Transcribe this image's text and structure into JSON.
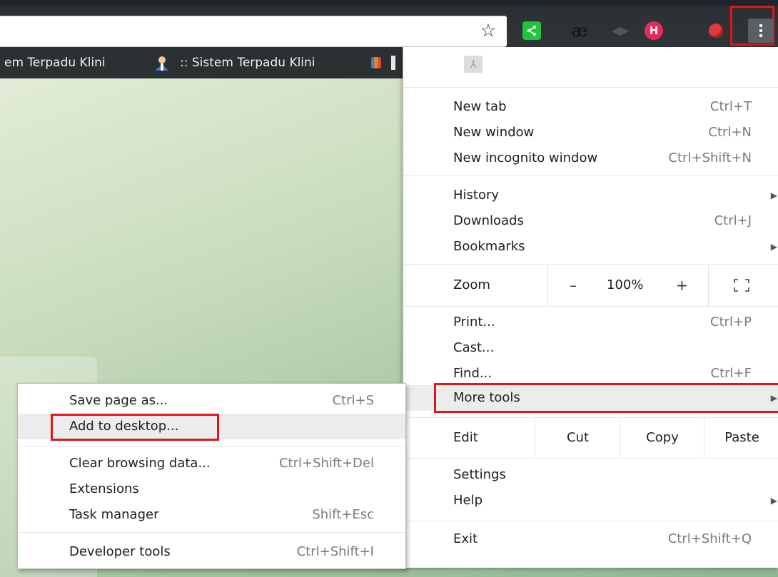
{
  "toolbar": {
    "star_icon": "☆",
    "ext_ae": "æ",
    "ext_h": "H",
    "menu_icon": "three-dot-menu"
  },
  "bookmarks": {
    "items": [
      "em Terpadu Klini",
      ":: Sistem Terpadu Klini"
    ]
  },
  "menu": {
    "new_tab": {
      "label": "New tab",
      "shortcut": "Ctrl+T"
    },
    "new_window": {
      "label": "New window",
      "shortcut": "Ctrl+N"
    },
    "new_incognito": {
      "label": "New incognito window",
      "shortcut": "Ctrl+Shift+N"
    },
    "history": {
      "label": "History"
    },
    "downloads": {
      "label": "Downloads",
      "shortcut": "Ctrl+J"
    },
    "bookmarks": {
      "label": "Bookmarks"
    },
    "zoom": {
      "label": "Zoom",
      "minus": "–",
      "value": "100%",
      "plus": "+"
    },
    "print": {
      "label": "Print...",
      "shortcut": "Ctrl+P"
    },
    "cast": {
      "label": "Cast..."
    },
    "find": {
      "label": "Find...",
      "shortcut": "Ctrl+F"
    },
    "more_tools": {
      "label": "More tools"
    },
    "edit": {
      "label": "Edit",
      "cut": "Cut",
      "copy": "Copy",
      "paste": "Paste"
    },
    "settings": {
      "label": "Settings"
    },
    "help": {
      "label": "Help"
    },
    "exit": {
      "label": "Exit",
      "shortcut": "Ctrl+Shift+Q"
    },
    "arrow": "▶"
  },
  "submenu": {
    "save_page": {
      "label": "Save page as...",
      "shortcut": "Ctrl+S"
    },
    "add_desktop": {
      "label": "Add to desktop..."
    },
    "clear_data": {
      "label": "Clear browsing data...",
      "shortcut": "Ctrl+Shift+Del"
    },
    "extensions": {
      "label": "Extensions"
    },
    "task_manager": {
      "label": "Task manager",
      "shortcut": "Shift+Esc"
    },
    "dev_tools": {
      "label": "Developer tools",
      "shortcut": "Ctrl+Shift+I"
    }
  },
  "colors": {
    "highlight_border": "#e0161c",
    "menu_hover": "#ececec"
  }
}
